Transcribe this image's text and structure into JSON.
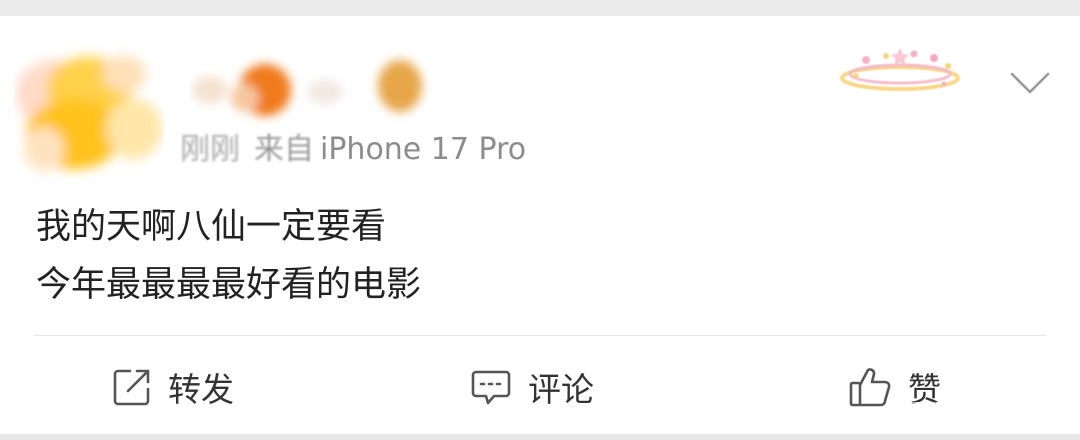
{
  "post": {
    "time": "刚刚",
    "from_prefix": "来自",
    "device": "iPhone 17 Pro",
    "text_line1": "我的天啊八仙一定要看",
    "text_line2": "今年最最最最好看的电影"
  },
  "actions": {
    "repost_label": "转发",
    "comment_label": "评论",
    "like_label": "赞"
  },
  "icons": {
    "menu": "chevron-down-icon",
    "repost": "share-out-icon",
    "comment": "comment-bubble-icon",
    "like": "thumbs-up-icon"
  },
  "colors": {
    "card_bg": "#ffffff",
    "page_bg": "#ededed",
    "text": "#222222",
    "meta": "#8c8c8c",
    "action_text": "#333333"
  }
}
